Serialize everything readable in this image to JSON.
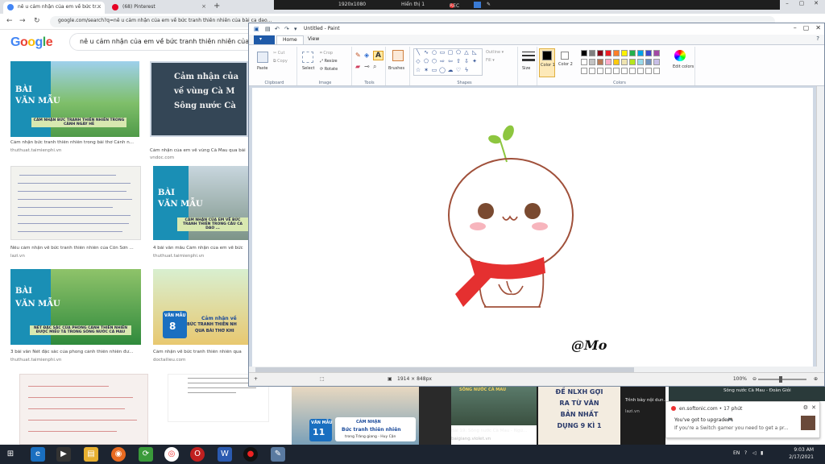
{
  "browser": {
    "tabs": [
      {
        "label": "nê u cảm nhận của em về bức tr...",
        "active": true
      },
      {
        "label": "(68) Pinterest",
        "active": false
      }
    ],
    "address": "google.com/search?q=nê u cảm nhận của em về bức tranh thiên nhiên của bài ca dao..."
  },
  "recorder": {
    "resolution": "1920x1080",
    "display": "Hiển thị 1",
    "rec_label": "REC"
  },
  "google": {
    "logo": "Google",
    "query": "nê u cảm nhận của em về bức tranh thiên nhiên của bài ca"
  },
  "results": [
    {
      "banner_a": "BÀI",
      "banner_b": "VĂN MẪU",
      "strip": "CẢM NHẬN BỨC TRANH THIÊN NHIÊN TRONG CẢNH NGÀY HÈ",
      "caption": "Cảm nhận bức tranh thiên nhiên trong bài thơ Cảnh n...",
      "source": "thuthuat.taimienphi.vn"
    },
    {
      "banner_a": "Cảm nhận của",
      "banner_b": "về vùng Cà M",
      "banner_c": "Sông nước Cà",
      "caption": "Cảm nhận của em về vùng Cà Mau qua bài",
      "source": "vndoc.com"
    },
    {
      "caption": "Nêu cảm nhận về bức tranh thiên nhiên của Côn Sơn ...",
      "source": "lazi.vn"
    },
    {
      "banner_a": "BÀI",
      "banner_b": "VĂN MẪU",
      "strip": "CẢM NHẬN CỦA EM VỀ BỨC TRANH THIÊN TRONG CÂU CA DAO ...",
      "caption": "4 bài văn mẫu Cảm nhận của em về bức",
      "source": "thuthuat.taimienphi.vn"
    },
    {
      "banner_a": "BÀI",
      "banner_b": "VĂN MẪU",
      "strip": "NÉT ĐẶC SẮC CỦA PHONG CẢNH THIÊN NHIÊN ĐƯỢC MIÊU TẢ TRONG SÔNG NƯỚC CÀ MAU",
      "caption": "3 bài văn Nét đặc sắc của phong cảnh thiên nhiên đư...",
      "source": "thuthuat.taimienphi.vn"
    },
    {
      "badge_a": "VĂN MẪU",
      "badge_num": "8",
      "banner_a": "Cảm nhận về",
      "banner_b": "BỨC TRANH THIÊN NH",
      "banner_c": "QUA BÀI THƠ KHI",
      "caption": "Cảm nhận về bức tranh thiên nhiên qua",
      "source": "doctailieu.com"
    }
  ],
  "bottom_results": [
    {
      "badge_a": "VĂN MẪU",
      "badge_num": "11",
      "title": "CẢM NHẬN",
      "subtitle": "Bức tranh thiên nhiên",
      "line": "trong Tràng giang - Huy Cận"
    },
    {
      "header": "SÔNG NƯỚC CÀ MAU",
      "caption": "Bài 19: Sông nước Cà Mau - Ngữ...",
      "source": "baigiang.violet.vn"
    },
    {
      "t1": "ĐỀ NLXH GỢI",
      "t2": "RA TỪ VĂN",
      "t3": "BẢN NHẤT",
      "t4": "DỤNG 9 KÌ 1"
    },
    {
      "caption": "Trình bày nội dun...",
      "source": "lazi.vn"
    },
    {
      "header": "Sông nước Cà Mau - Đoàn Giỏi"
    }
  ],
  "paint": {
    "title": "Untitled - Paint",
    "tabs": [
      "Home",
      "View"
    ],
    "groups": {
      "clipboard": "Clipboard",
      "image": "Image",
      "tools": "Tools",
      "shapes": "Shapes",
      "colors": "Colors"
    },
    "buttons": {
      "paste": "Paste",
      "cut": "Cut",
      "copy": "Copy",
      "select": "Select",
      "crop": "Crop",
      "resize": "Resize",
      "rotate": "Rotate",
      "brushes": "Brushes",
      "outline": "Outline",
      "fill": "Fill",
      "size": "Size",
      "color1": "Color 1",
      "color2": "Color 2",
      "edit_colors": "Edit colors"
    },
    "palette": [
      "#000000",
      "#7f7f7f",
      "#880015",
      "#ed1c24",
      "#ff7f27",
      "#fff200",
      "#22b14c",
      "#00a2e8",
      "#3f48cc",
      "#a349a4",
      "#ffffff",
      "#c3c3c3",
      "#b97a57",
      "#ffaec9",
      "#ffc90e",
      "#efe4b0",
      "#b5e61d",
      "#99d9ea",
      "#7092be",
      "#c8bfe7",
      "#ffffff",
      "#ffffff",
      "#ffffff",
      "#ffffff",
      "#ffffff",
      "#ffffff",
      "#ffffff",
      "#ffffff",
      "#ffffff",
      "#ffffff"
    ],
    "canvas": {
      "signature": "@Mo",
      "outline_color": "#a0503a",
      "sprout_color": "#8dc63f",
      "scarf_color": "#e53030",
      "eye_color": "#7a4a30",
      "blush_color": "#f7b5bd"
    },
    "status": {
      "dimensions": "1914 × 848px",
      "zoom": "100%"
    }
  },
  "toast": {
    "site": "en.softonic.com • 17 phút",
    "line1": "You've got to upgrade🎮",
    "line2": "If you're a Switch gamer you need to get a pr..."
  },
  "taskbar": {
    "lang": "EN",
    "time": "9:03 AM",
    "date": "2/17/2021"
  }
}
